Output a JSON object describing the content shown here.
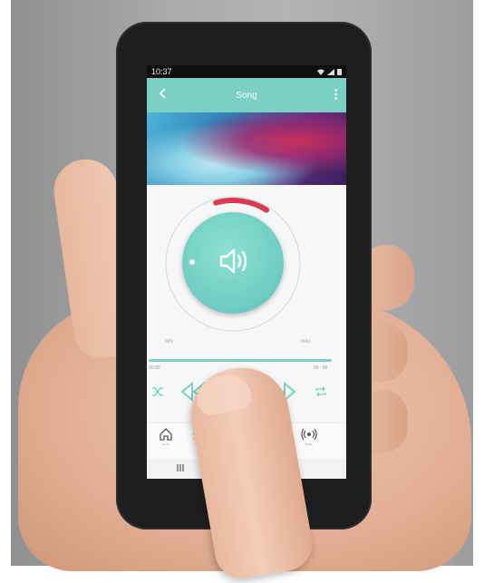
{
  "status": {
    "time": "10:37"
  },
  "appbar": {
    "title": "Song"
  },
  "dial": {
    "min_label": "MIN",
    "max_label": "MAX",
    "volume_fraction": 0.22
  },
  "track": {
    "elapsed": "00:00",
    "total": "00 : 00",
    "progress_fraction": 1.0
  },
  "nav": [
    {
      "icon": "home-icon",
      "label": "Home"
    },
    {
      "icon": "list-icon",
      "label": "Library"
    },
    {
      "icon": "radio-icon",
      "label": "Radio"
    }
  ],
  "colors": {
    "accent": "#7ccfc4",
    "volume_arc": "#d93a50",
    "status_bar": "#0f0f10"
  }
}
